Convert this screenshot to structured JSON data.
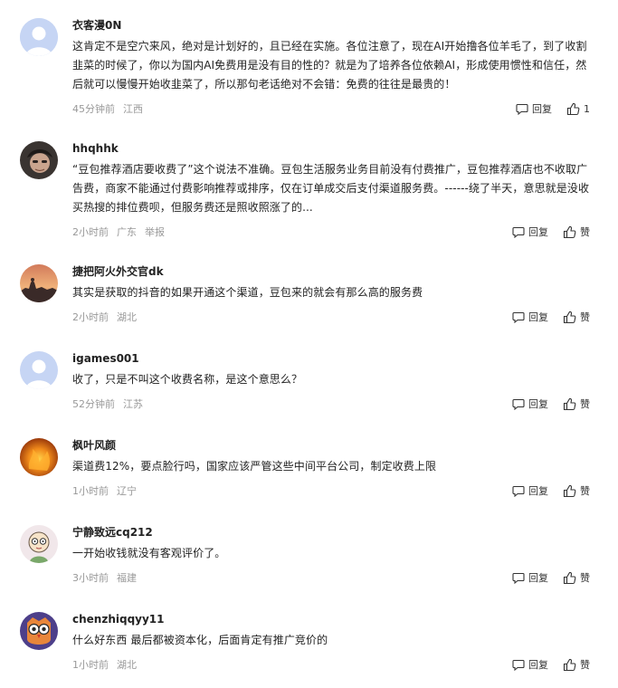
{
  "actions": {
    "reply": "回复",
    "like": "赞",
    "report": "举报"
  },
  "comments": [
    {
      "username": "衣客漫0N",
      "text": "这肯定不是空穴来风，绝对是计划好的，且已经在实施。各位注意了，现在AI开始撸各位羊毛了，到了收割韭菜的时候了，你以为国内AI免费用是没有目的性的？就是为了培养各位依赖AI，形成使用惯性和信任，然后就可以慢慢开始收韭菜了，所以那句老话绝对不会错：免费的往往是最贵的！",
      "time": "45分钟前",
      "location": "江西",
      "like_label": "1",
      "avatar": "default-avatar"
    },
    {
      "username": "hhqhhk",
      "text": "“豆包推荐酒店要收费了”这个说法不准确。豆包生活服务业务目前没有付费推广，豆包推荐酒店也不收取广告费，商家不能通过付费影响推荐或排序，仅在订单成交后支付渠道服务费。------绕了半天，意思就是没收买热搜的排位费呗，但服务费还是照收照涨了的...",
      "time": "2小时前",
      "location": "广东",
      "report": "举报",
      "like_label": "赞",
      "avatar": "photo-avatar"
    },
    {
      "username": "捷把阿火外交官dk",
      "text": "其实是获取的抖音的如果开通这个渠道，豆包来的就会有那么高的服务费",
      "time": "2小时前",
      "location": "湖北",
      "like_label": "赞",
      "avatar": "sunset-avatar"
    },
    {
      "username": "igames001",
      "text": "收了，只是不叫这个收费名称，是这个意思么？",
      "time": "52分钟前",
      "location": "江苏",
      "like_label": "赞",
      "avatar": "default-avatar"
    },
    {
      "username": "枫叶风颜",
      "text": "渠道费12%，要点脸行吗，国家应该严管这些中间平台公司，制定收费上限",
      "time": "1小时前",
      "location": "辽宁",
      "like_label": "赞",
      "avatar": "fire-avatar"
    },
    {
      "username": "宁静致远cq212",
      "text": "一开始收钱就没有客观评价了。",
      "time": "3小时前",
      "location": "福建",
      "like_label": "赞",
      "avatar": "cartoon-avatar"
    },
    {
      "username": "chenzhiqqyy11",
      "text": "什么好东西 最后都被资本化，后面肯定有推广竞价的",
      "time": "1小时前",
      "location": "湖北",
      "like_label": "赞",
      "avatar": "owl-avatar"
    }
  ]
}
